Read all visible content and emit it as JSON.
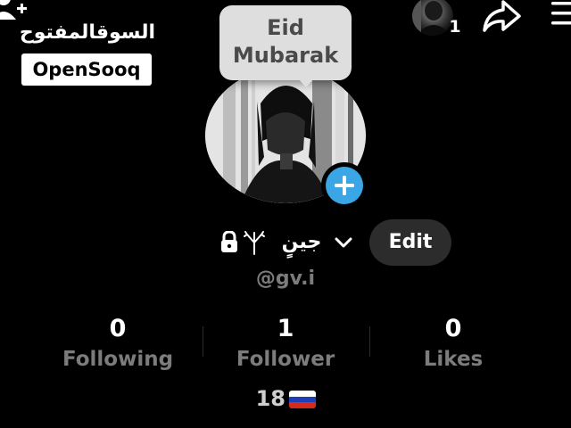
{
  "watermark": {
    "arabic": "السوقالمفتوح",
    "brand": "OpenSooq"
  },
  "top_bar": {
    "notification_count": "1"
  },
  "bubble": {
    "line1": "Eid",
    "line2": "Mubarak"
  },
  "profile": {
    "display_name": "جينٍ",
    "handle": "@gv.i",
    "edit_label": "Edit",
    "age_text": "18"
  },
  "stats": [
    {
      "value": "0",
      "label": "Following"
    },
    {
      "value": "1",
      "label": "Follower"
    },
    {
      "value": "0",
      "label": "Likes"
    }
  ],
  "icons": {
    "add_user": "add-user-icon",
    "share": "share-icon",
    "menu": "menu-icon",
    "lock": "lock-icon",
    "tree": "tree-symbol-icon",
    "chevron": "chevron-down-icon",
    "add": "plus-icon",
    "flag": "russia-flag-icon"
  },
  "colors": {
    "background": "#000000",
    "accent_blue": "#3aa6e6",
    "muted_text": "#7c7c7c",
    "bubble": "#dedede",
    "edit_button": "#2c2c2c"
  }
}
